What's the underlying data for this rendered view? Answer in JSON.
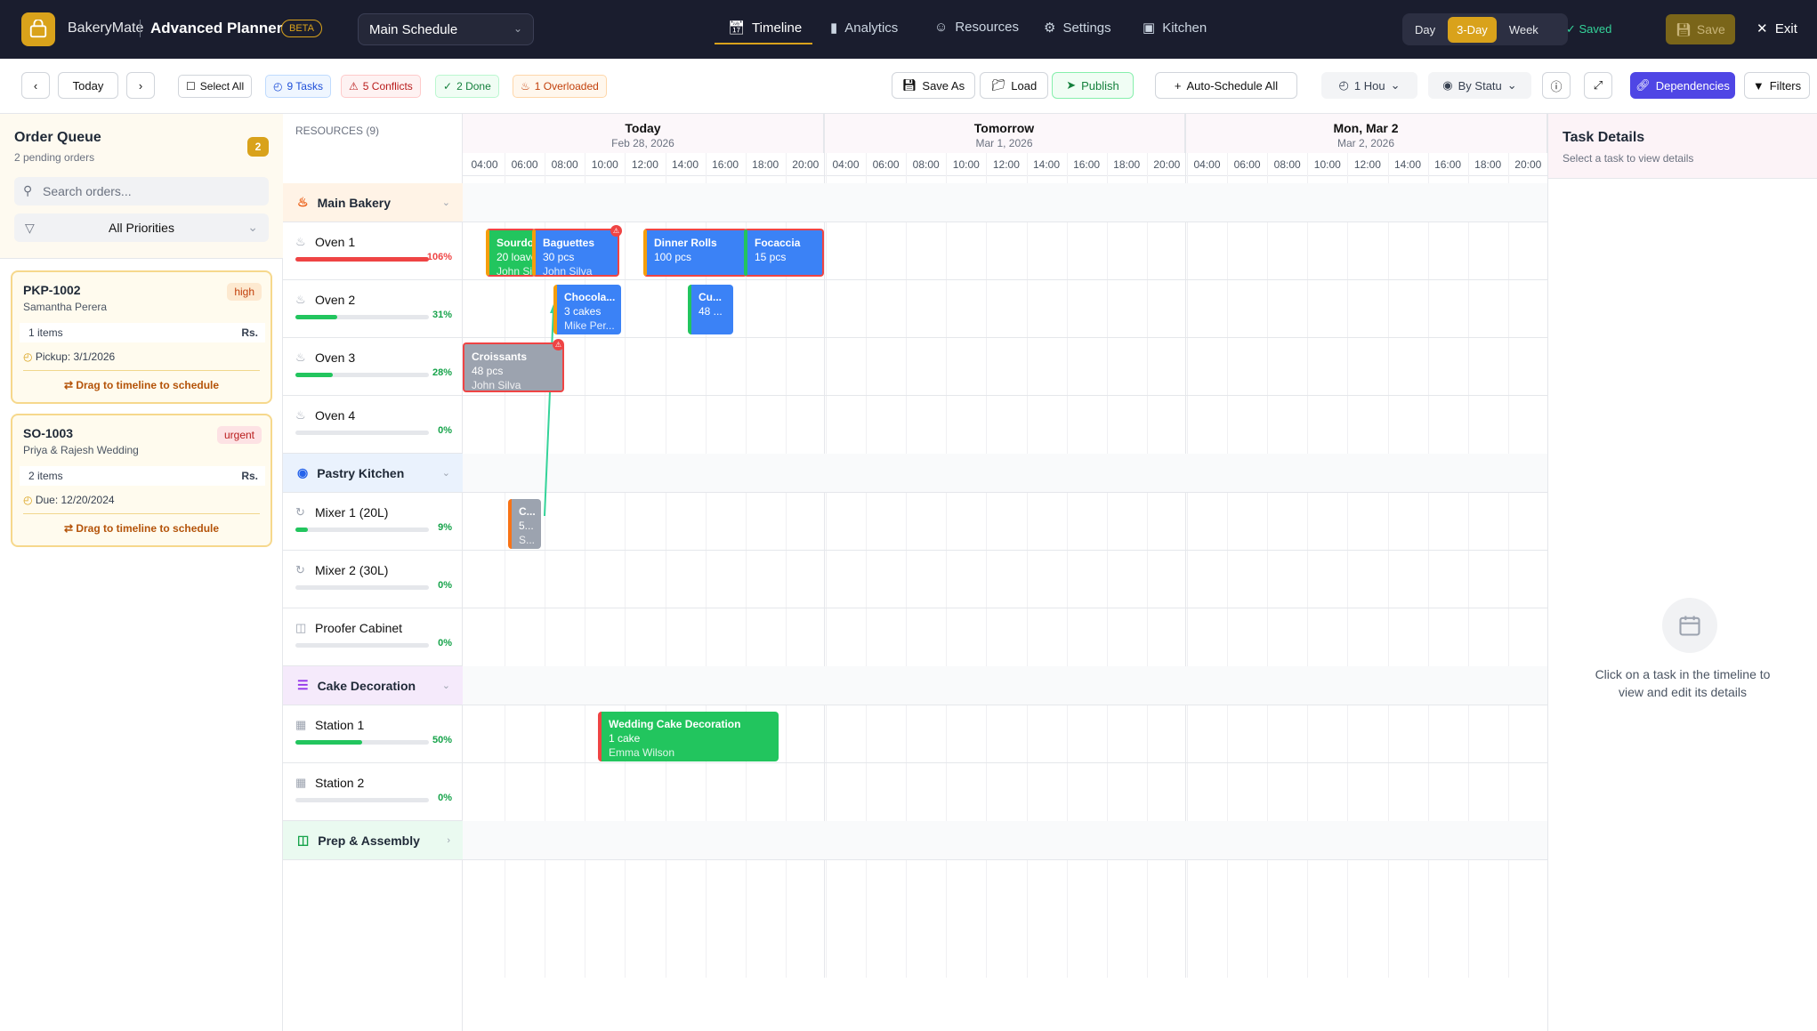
{
  "app": {
    "brand": "BakeryMate",
    "product": "Advanced Planner",
    "beta": "BETA",
    "schedule_select": "Main Schedule"
  },
  "nav": {
    "tabs": [
      {
        "label": "Timeline",
        "icon": "calendar-icon"
      },
      {
        "label": "Analytics",
        "icon": "bar-chart-icon"
      },
      {
        "label": "Resources",
        "icon": "users-icon"
      },
      {
        "label": "Settings",
        "icon": "gear-icon"
      },
      {
        "label": "Kitchen",
        "icon": "monitor-icon"
      }
    ]
  },
  "views": {
    "day": "Day",
    "three_day": "3-Day",
    "week": "Week",
    "active": "3-Day"
  },
  "status": {
    "saved": "Saved",
    "save": "Save",
    "exit": "Exit"
  },
  "toolbar": {
    "today": "Today",
    "select_all": "Select All",
    "tasks": "9 Tasks",
    "conflicts": "5 Conflicts",
    "done": "2 Done",
    "overloaded": "1 Overloaded",
    "save_as": "Save As",
    "load": "Load",
    "publish": "Publish",
    "auto_schedule": "Auto-Schedule All",
    "interval": "1 Hou",
    "color_by": "By Statu",
    "dependencies": "Dependencies",
    "filters": "Filters"
  },
  "colors": {
    "accent": "#d9a21b",
    "conflict": "#ef4444",
    "blue_task": "#3b82f6",
    "gray_task": "#9ca3af",
    "green_task": "#22c55e",
    "primary": "#4f46e5"
  },
  "queue": {
    "title": "Order Queue",
    "subtitle": "2 pending orders",
    "count": "2",
    "search_placeholder": "Search orders...",
    "priority_filter": "All Priorities",
    "orders": [
      {
        "id": "PKP-1002",
        "customer": "Samantha Perera",
        "priority": "high",
        "items": "1 items",
        "currency": "Rs.",
        "date": "Pickup: 3/1/2026",
        "drag": "Drag to timeline to schedule"
      },
      {
        "id": "SO-1003",
        "customer": "Priya & Rajesh Wedding",
        "priority": "urgent",
        "items": "2 items",
        "currency": "Rs.",
        "date": "Due: 12/20/2024",
        "drag": "Drag to timeline to schedule"
      }
    ]
  },
  "resources": {
    "header": "RESOURCES (9)",
    "groups": [
      {
        "name": "Main Bakery",
        "color": "#fff3e6",
        "icon": "flame-icon",
        "items": [
          {
            "name": "Oven 1",
            "pct": "106%",
            "value": 1.0,
            "color": "#ef4444",
            "icon": "flame-icon"
          },
          {
            "name": "Oven 2",
            "pct": "31%",
            "value": 0.31,
            "color": "#22c55e",
            "icon": "flame-icon"
          },
          {
            "name": "Oven 3",
            "pct": "28%",
            "value": 0.28,
            "color": "#22c55e",
            "icon": "flame-icon"
          },
          {
            "name": "Oven 4",
            "pct": "0%",
            "value": 0,
            "color": "#22c55e",
            "icon": "flame-icon"
          }
        ]
      },
      {
        "name": "Pastry Kitchen",
        "color": "#eaf2fd",
        "icon": "chef-hat-icon",
        "items": [
          {
            "name": "Mixer 1 (20L)",
            "pct": "9%",
            "value": 0.09,
            "color": "#22c55e",
            "icon": "refresh-icon"
          },
          {
            "name": "Mixer 2 (30L)",
            "pct": "0%",
            "value": 0,
            "color": "#22c55e",
            "icon": "refresh-icon"
          },
          {
            "name": "Proofer Cabinet",
            "pct": "0%",
            "value": 0,
            "color": "#22c55e",
            "icon": "box-icon"
          }
        ]
      },
      {
        "name": "Cake Decoration",
        "color": "#f5eafb",
        "icon": "layers-icon",
        "items": [
          {
            "name": "Station 1",
            "pct": "50%",
            "value": 0.5,
            "color": "#22c55e",
            "icon": "grid-icon"
          },
          {
            "name": "Station 2",
            "pct": "0%",
            "value": 0,
            "color": "#22c55e",
            "icon": "grid-icon"
          }
        ]
      },
      {
        "name": "Prep & Assembly",
        "color": "#eafaf0",
        "icon": "package-icon",
        "items": []
      }
    ]
  },
  "timeline": {
    "days": [
      {
        "name": "Today",
        "date": "Feb 28, 2026"
      },
      {
        "name": "Tomorrow",
        "date": "Mar 1, 2026"
      },
      {
        "name": "Mon, Mar 2",
        "date": "Mar 2, 2026"
      }
    ],
    "hours": [
      "04:00",
      "06:00",
      "08:00",
      "10:00",
      "12:00",
      "14:00",
      "16:00",
      "18:00",
      "20:00"
    ],
    "tasks": [
      {
        "title": "Sourdo",
        "qty": "20 loave",
        "assignee": "John Sil",
        "resource": "Oven 1",
        "status": "in-progress"
      },
      {
        "title": "Baguettes",
        "qty": "30 pcs",
        "assignee": "John Silva",
        "resource": "Oven 1",
        "status": "conflict"
      },
      {
        "title": "Dinner Rolls",
        "qty": "100 pcs",
        "assignee": "",
        "resource": "Oven 1",
        "status": "conflict"
      },
      {
        "title": "Focaccia",
        "qty": "15 pcs",
        "assignee": "",
        "resource": "Oven 1",
        "status": "conflict"
      },
      {
        "title": "Chocola...",
        "qty": "3 cakes",
        "assignee": "Mike Per...",
        "resource": "Oven 2",
        "status": "scheduled"
      },
      {
        "title": "Cu...",
        "qty": "48 ...",
        "assignee": "",
        "resource": "Oven 2",
        "status": "scheduled"
      },
      {
        "title": "Croissants",
        "qty": "48 pcs",
        "assignee": "John Silva",
        "resource": "Oven 3",
        "status": "done"
      },
      {
        "title": "C...",
        "qty": "5...",
        "assignee": "S...",
        "resource": "Mixer 1 (20L)",
        "status": "done"
      },
      {
        "title": "Wedding Cake Decoration",
        "qty": "1 cake",
        "assignee": "Emma Wilson",
        "resource": "Station 1",
        "status": "in-progress"
      }
    ]
  },
  "details": {
    "title": "Task Details",
    "subtitle": "Select a task to view details",
    "empty": "Click on a task in the timeline to view and edit its details"
  }
}
